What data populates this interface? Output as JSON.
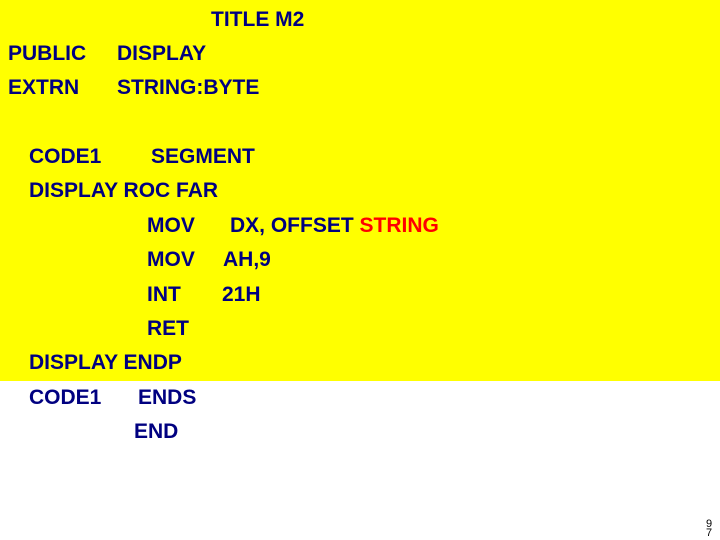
{
  "colors": {
    "background_top": "#ffff00",
    "background_bottom": "#ffffff",
    "text": "#000080",
    "highlight": "#ff0000"
  },
  "code": {
    "title": "TITLE M2",
    "public_kw": "PUBLIC",
    "public_arg": "DISPLAY",
    "extrn_kw": "EXTRN",
    "extrn_arg": "STRING:BYTE",
    "seg_name": "CODE1",
    "seg_kw": "SEGMENT",
    "proc_line": "DISPLAY ROC FAR",
    "mov1_op": "MOV",
    "mov1_arg": "DX, OFFSET",
    "mov1_highlight": "STRING",
    "mov2_op": "MOV",
    "mov2_arg": "AH,9",
    "int_op": "INT",
    "int_arg": "21H",
    "ret_op": "RET",
    "endp_line": "DISPLAY ENDP",
    "ends_name": "CODE1",
    "ends_kw": "ENDS",
    "end_kw": "END"
  },
  "slide_number": {
    "top": "9",
    "bottom": "7"
  }
}
